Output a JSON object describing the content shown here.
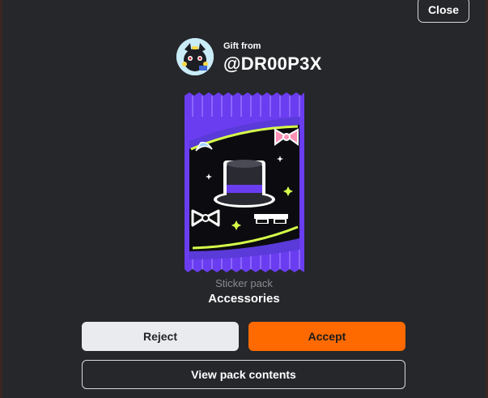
{
  "close_label": "Close",
  "gift": {
    "from_label": "Gift from",
    "username": "@DR00P3X"
  },
  "pack": {
    "type": "Sticker pack",
    "name": "Accessories",
    "colors": {
      "wrapper": "#6a3df0",
      "inner": "#0c0c10",
      "accent": "#d6ff4a"
    }
  },
  "buttons": {
    "reject": "Reject",
    "accept": "Accept",
    "view_contents": "View pack contents"
  },
  "colors": {
    "accept": "#ff6a00",
    "reject": "#e9ebee",
    "modal_bg": "#26272b"
  }
}
